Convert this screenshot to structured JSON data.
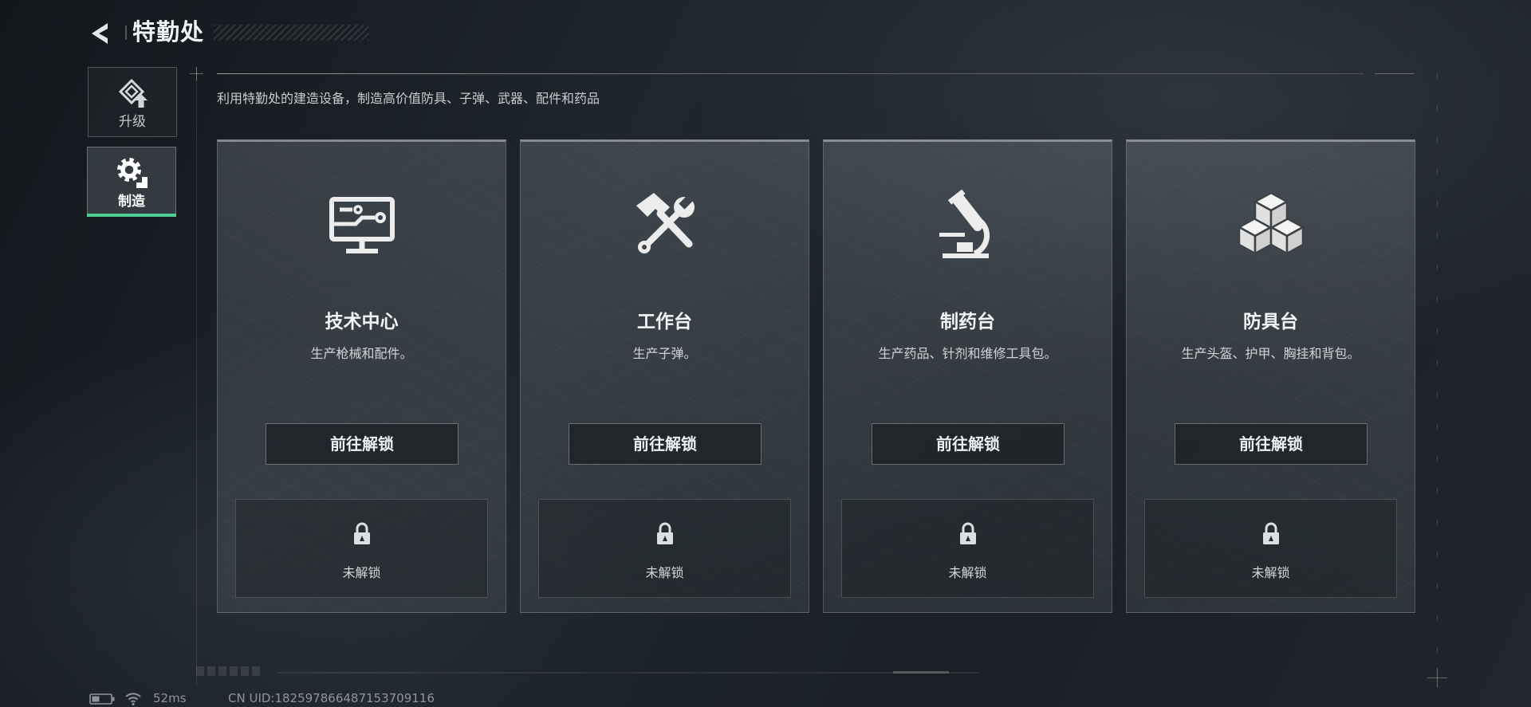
{
  "header": {
    "title": "特勤处",
    "back_icon": "back-arrow-icon"
  },
  "sidebar": {
    "items": [
      {
        "label": "升级",
        "icon": "upgrade-icon",
        "active": false
      },
      {
        "label": "制造",
        "icon": "gears-icon",
        "active": true
      }
    ]
  },
  "subtitle": "利用特勤处的建造设备，制造高价值防具、子弹、武器、配件和药品",
  "cards": [
    {
      "title": "技术中心",
      "desc": "生产枪械和配件。",
      "button": "前往解锁",
      "status": "未解锁",
      "icon": "monitor-icon"
    },
    {
      "title": "工作台",
      "desc": "生产子弹。",
      "button": "前往解锁",
      "status": "未解锁",
      "icon": "hammer-wrench-icon"
    },
    {
      "title": "制药台",
      "desc": "生产药品、针剂和维修工具包。",
      "button": "前往解锁",
      "status": "未解锁",
      "icon": "microscope-icon"
    },
    {
      "title": "防具台",
      "desc": "生产头盔、护甲、胸挂和背包。",
      "button": "前往解锁",
      "status": "未解锁",
      "icon": "cubes-icon"
    }
  ],
  "status_bar": {
    "ping": "52ms",
    "uid": "CN UID:182597866487153709116",
    "battery_icon": "battery-icon",
    "wifi_icon": "wifi-icon"
  },
  "colors": {
    "accent": "#4ecf96",
    "background": "#1c2228",
    "icon": "#ececec"
  }
}
